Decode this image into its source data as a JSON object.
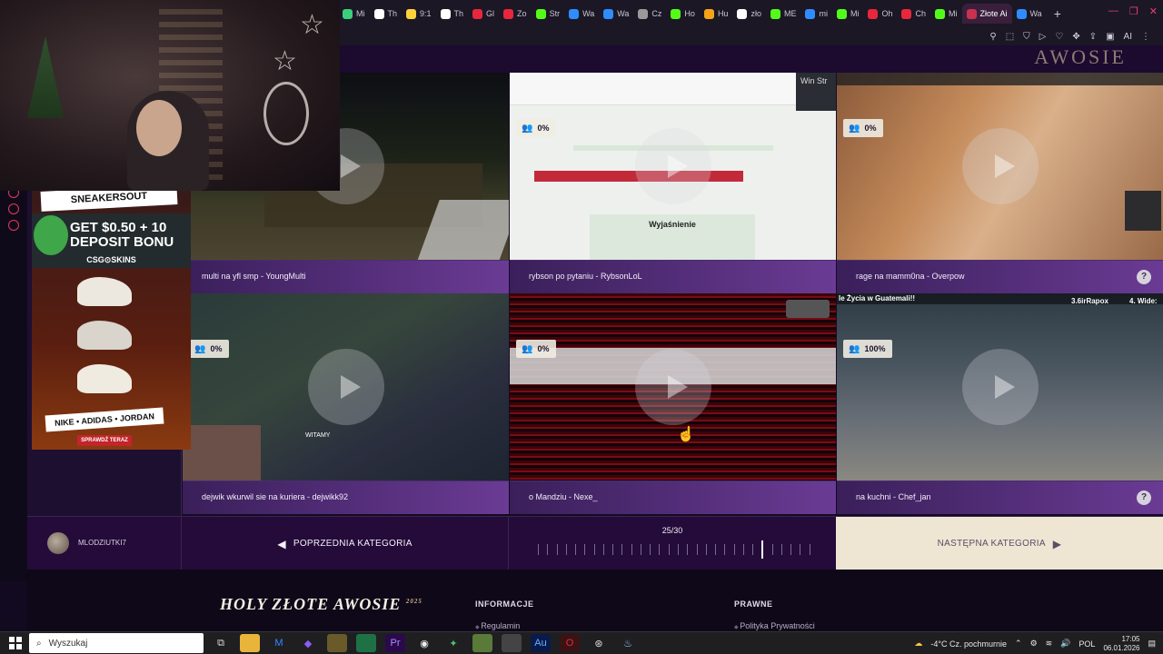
{
  "browser": {
    "tabs": [
      {
        "label": "Mi",
        "color": "#3ad07a"
      },
      {
        "label": "Th",
        "color": "#ffffff"
      },
      {
        "label": "9:1",
        "color": "#ffd23a"
      },
      {
        "label": "Th",
        "color": "#ffffff"
      },
      {
        "label": "Gl",
        "color": "#e8273c"
      },
      {
        "label": "Zo",
        "color": "#e8273c"
      },
      {
        "label": "Str",
        "color": "#53fc18"
      },
      {
        "label": "Wa",
        "color": "#2f8cff"
      },
      {
        "label": "Wa",
        "color": "#2f8cff"
      },
      {
        "label": "Cz",
        "color": "#9a9a9a"
      },
      {
        "label": "Ho",
        "color": "#53fc18"
      },
      {
        "label": "Hu",
        "color": "#f4a417"
      },
      {
        "label": "zło",
        "color": "#ffffff"
      },
      {
        "label": "ME",
        "color": "#53fc18"
      },
      {
        "label": "mi",
        "color": "#2f8cff"
      },
      {
        "label": "Mi",
        "color": "#53fc18"
      },
      {
        "label": "Oh",
        "color": "#e8273c"
      },
      {
        "label": "Ch",
        "color": "#e8273c"
      },
      {
        "label": "Mi",
        "color": "#53fc18"
      },
      {
        "label": "Złote Ai",
        "color": "#c8324f",
        "active": true
      },
      {
        "label": "Wa",
        "color": "#2f8cff"
      }
    ],
    "new_tab": "+",
    "ai_label": "AI"
  },
  "site": {
    "header_logo": "AWOSIE"
  },
  "ad": {
    "title": "SNEAKERSOUT",
    "promo": "GET $0.50 + 10 DEPOSIT BONU",
    "brand": "CSG⊙SKINS",
    "brands_strip": "NIKE • ADIDAS • JORDAN",
    "cta": "SPRAWDŹ TERAZ"
  },
  "clips": [
    {
      "caption": "multi na yfl smp - YoungMulti",
      "percent": "",
      "has_help": false
    },
    {
      "caption": "rybson po pytaniu - RybsonLoL",
      "percent": "0%",
      "has_help": false
    },
    {
      "caption": "rage na mamm0na - Overpow",
      "percent": "0%",
      "has_help": true
    },
    {
      "caption": "dejwik wkurwil sie na kuriera - dejwikk92",
      "percent": "0%",
      "has_help": false
    },
    {
      "caption": "o Mandziu - Nexe_",
      "percent": "0%",
      "has_help": false
    },
    {
      "caption": "na kuchni - Chef_jan",
      "percent": "100%",
      "has_help": true
    }
  ],
  "clip_overlays": {
    "quiz_heading": "Wyjaśnienie",
    "stream_text": "Win Str",
    "witamy": "WITAMY",
    "guatemala": "le Życia w Guatemali!!",
    "rapox": "3.6irRapox",
    "wide": "4. Wide:"
  },
  "catnav": {
    "username": "MLODZIUTKI7",
    "prev_label": "POPRZEDNIA KATEGORIA",
    "progress_label": "25/30",
    "progress_current": 25,
    "progress_total": 30,
    "next_label": "NASTĘPNA KATEGORIA"
  },
  "footer": {
    "logo": "HOLY ZŁOTE AWOSIE",
    "logo_year": "2025",
    "col1_title": "INFORMACJE",
    "col1_link": "Regulamin",
    "col2_title": "PRAWNE",
    "col2_link": "Polityka Prywatności"
  },
  "taskbar": {
    "search_placeholder": "Wyszukaj",
    "weather": "-4°C  Cz. pochmurnie",
    "lang": "POL",
    "time": "17:05",
    "date": "06.01.2026"
  }
}
